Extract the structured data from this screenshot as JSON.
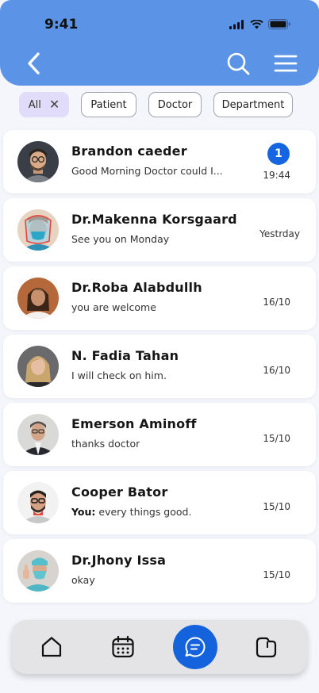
{
  "status_bar": {
    "time": "9:41"
  },
  "header": {
    "back_icon": "chevron-left-icon",
    "search_icon": "search-icon",
    "menu_icon": "hamburger-menu-icon",
    "background_color": "#5b94e6"
  },
  "filters": [
    {
      "label": "All",
      "active": true
    },
    {
      "label": "Patient",
      "active": false
    },
    {
      "label": "Doctor",
      "active": false
    },
    {
      "label": "Department",
      "active": false
    }
  ],
  "conversations": [
    {
      "name": "Brandon caeder",
      "message": "Good Morning Doctor could I...",
      "time": "19:44",
      "unread": "1"
    },
    {
      "name": "Dr.Makenna Korsgaard",
      "message": "See you on Monday",
      "time": "Yestrday"
    },
    {
      "name": "Dr.Roba Alabdullh",
      "message": "you are welcome",
      "time": "16/10"
    },
    {
      "name": "N. Fadia Tahan",
      "message": "I will check on him.",
      "time": "16/10"
    },
    {
      "name": "Emerson Aminoff",
      "message": "thanks doctor",
      "time": "15/10"
    },
    {
      "name": "Cooper Bator",
      "message_prefix": "You:",
      "message": "every things good.",
      "time": "15/10"
    },
    {
      "name": "Dr.Jhony Issa",
      "message": "okay",
      "time": "15/10"
    }
  ],
  "bottom_nav": {
    "items": [
      "home-icon",
      "calendar-icon",
      "chat-icon",
      "folder-icon"
    ],
    "active": "chat-icon",
    "accent_color": "#1463dd"
  },
  "colors": {
    "unread_badge": "#1565e0",
    "active_chip": "#e1dcfa"
  }
}
